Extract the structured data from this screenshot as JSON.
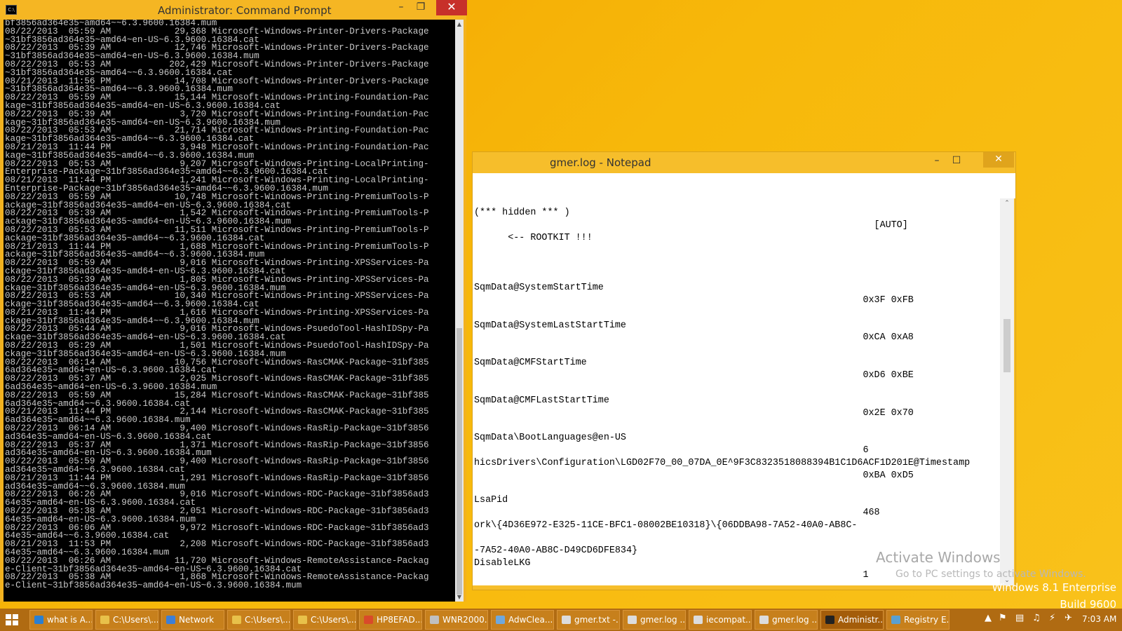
{
  "cmd": {
    "title": "Administrator: Command Prompt",
    "lines": [
      "bf3856ad364e35~amd64~~6.3.9600.16384.mum",
      "08/22/2013  05:59 AM            29,368 Microsoft-Windows-Printer-Drivers-Package",
      "~31bf3856ad364e35~amd64~en-US~6.3.9600.16384.cat",
      "08/22/2013  05:39 AM            12,746 Microsoft-Windows-Printer-Drivers-Package",
      "~31bf3856ad364e35~amd64~en-US~6.3.9600.16384.mum",
      "08/22/2013  05:53 AM           202,429 Microsoft-Windows-Printer-Drivers-Package",
      "~31bf3856ad364e35~amd64~~6.3.9600.16384.cat",
      "08/21/2013  11:56 PM            14,708 Microsoft-Windows-Printer-Drivers-Package",
      "~31bf3856ad364e35~amd64~~6.3.9600.16384.mum",
      "08/22/2013  05:59 AM            15,144 Microsoft-Windows-Printing-Foundation-Pac",
      "kage~31bf3856ad364e35~amd64~en-US~6.3.9600.16384.cat",
      "08/22/2013  05:39 AM             3,720 Microsoft-Windows-Printing-Foundation-Pac",
      "kage~31bf3856ad364e35~amd64~en-US~6.3.9600.16384.mum",
      "08/22/2013  05:53 AM            21,714 Microsoft-Windows-Printing-Foundation-Pac",
      "kage~31bf3856ad364e35~amd64~~6.3.9600.16384.cat",
      "08/21/2013  11:44 PM             3,948 Microsoft-Windows-Printing-Foundation-Pac",
      "kage~31bf3856ad364e35~amd64~~6.3.9600.16384.mum",
      "08/22/2013  05:53 AM             9,207 Microsoft-Windows-Printing-LocalPrinting-",
      "Enterprise-Package~31bf3856ad364e35~amd64~~6.3.9600.16384.cat",
      "08/21/2013  11:44 PM             1,241 Microsoft-Windows-Printing-LocalPrinting-",
      "Enterprise-Package~31bf3856ad364e35~amd64~~6.3.9600.16384.mum",
      "08/22/2013  05:59 AM            10,748 Microsoft-Windows-Printing-PremiumTools-P",
      "ackage~31bf3856ad364e35~amd64~en-US~6.3.9600.16384.cat",
      "08/22/2013  05:39 AM             1,542 Microsoft-Windows-Printing-PremiumTools-P",
      "ackage~31bf3856ad364e35~amd64~en-US~6.3.9600.16384.mum",
      "08/22/2013  05:53 AM            11,511 Microsoft-Windows-Printing-PremiumTools-P",
      "ackage~31bf3856ad364e35~amd64~~6.3.9600.16384.cat",
      "08/21/2013  11:44 PM             1,688 Microsoft-Windows-Printing-PremiumTools-P",
      "ackage~31bf3856ad364e35~amd64~~6.3.9600.16384.mum",
      "08/22/2013  05:59 AM             9,016 Microsoft-Windows-Printing-XPSServices-Pa",
      "ckage~31bf3856ad364e35~amd64~en-US~6.3.9600.16384.cat",
      "08/22/2013  05:39 AM             1,805 Microsoft-Windows-Printing-XPSServices-Pa",
      "ckage~31bf3856ad364e35~amd64~en-US~6.3.9600.16384.mum",
      "08/22/2013  05:53 AM            10,340 Microsoft-Windows-Printing-XPSServices-Pa",
      "ckage~31bf3856ad364e35~amd64~~6.3.9600.16384.cat",
      "08/21/2013  11:44 PM             1,616 Microsoft-Windows-Printing-XPSServices-Pa",
      "ckage~31bf3856ad364e35~amd64~~6.3.9600.16384.mum",
      "08/22/2013  05:44 AM             9,016 Microsoft-Windows-PsuedoTool-HashIDSpy-Pa",
      "ckage~31bf3856ad364e35~amd64~en-US~6.3.9600.16384.cat",
      "08/22/2013  05:29 AM             1,501 Microsoft-Windows-PsuedoTool-HashIDSpy-Pa",
      "ckage~31bf3856ad364e35~amd64~en-US~6.3.9600.16384.mum",
      "08/22/2013  06:14 AM            10,756 Microsoft-Windows-RasCMAK-Package~31bf385",
      "6ad364e35~amd64~en-US~6.3.9600.16384.cat",
      "08/22/2013  05:37 AM             2,025 Microsoft-Windows-RasCMAK-Package~31bf385",
      "6ad364e35~amd64~en-US~6.3.9600.16384.mum",
      "08/22/2013  05:59 AM            15,284 Microsoft-Windows-RasCMAK-Package~31bf385",
      "6ad364e35~amd64~~6.3.9600.16384.cat",
      "08/21/2013  11:44 PM             2,144 Microsoft-Windows-RasCMAK-Package~31bf385",
      "6ad364e35~amd64~~6.3.9600.16384.mum",
      "08/22/2013  06:14 AM             9,400 Microsoft-Windows-RasRip-Package~31bf3856",
      "ad364e35~amd64~en-US~6.3.9600.16384.cat",
      "08/22/2013  05:37 AM             1,371 Microsoft-Windows-RasRip-Package~31bf3856",
      "ad364e35~amd64~en-US~6.3.9600.16384.mum",
      "08/22/2013  05:59 AM             9,400 Microsoft-Windows-RasRip-Package~31bf3856",
      "ad364e35~amd64~~6.3.9600.16384.cat",
      "08/21/2013  11:44 PM             1,291 Microsoft-Windows-RasRip-Package~31bf3856",
      "ad364e35~amd64~~6.3.9600.16384.mum",
      "08/22/2013  06:26 AM             9,016 Microsoft-Windows-RDC-Package~31bf3856ad3",
      "64e35~amd64~en-US~6.3.9600.16384.cat",
      "08/22/2013  05:38 AM             2,051 Microsoft-Windows-RDC-Package~31bf3856ad3",
      "64e35~amd64~en-US~6.3.9600.16384.mum",
      "08/22/2013  06:06 AM             9,972 Microsoft-Windows-RDC-Package~31bf3856ad3",
      "64e35~amd64~~6.3.9600.16384.cat",
      "08/21/2013  11:53 PM             2,208 Microsoft-Windows-RDC-Package~31bf3856ad3",
      "64e35~amd64~~6.3.9600.16384.mum",
      "08/22/2013  06:26 AM            11,720 Microsoft-Windows-RemoteAssistance-Packag",
      "e-Client~31bf3856ad364e35~amd64~en-US~6.3.9600.16384.cat",
      "08/22/2013  05:38 AM             1,868 Microsoft-Windows-RemoteAssistance-Packag",
      "e-Client~31bf3856ad364e35~amd64~en-US~6.3.9600.16384.mum"
    ]
  },
  "notepad": {
    "title": "gmer.log - Notepad",
    "text": "(*** hidden *** )\n                                                                       [AUTO]\n      <-- ROOTKIT !!!\n\n\n\nSqmData@SystemStartTime\n                                                                     0x3F 0xFB\n\nSqmData@SystemLastStartTime\n                                                                     0xCA 0xA8\n\nSqmData@CMFStartTime\n                                                                     0xD6 0xBE\n\nSqmData@CMFLastStartTime\n                                                                     0x2E 0x70\n\nSqmData\\BootLanguages@en-US\n                                                                     6\nhicsDrivers\\Configuration\\LGD02F70_00_07DA_0E^9F3C8323518088394B1C1D6ACF1D201E@Timestamp\n                                                                     0xBA 0xD5\n\nLsaPid\n                                                                     468\nork\\{4D36E972-E325-11CE-BFC1-08002BE10318}\\{06DDBA98-7A52-40A0-AB8C-\n\n-7A52-40A0-AB8C-D49CD6DFE834}\nDisableLKG\n                                                                     1"
  },
  "watermark": {
    "line1": "Activate Windows",
    "line2": "Go to PC settings to activate Windows.",
    "edition": "Windows 8.1 Enterprise",
    "build": "Build 9600"
  },
  "taskbar": {
    "items": [
      {
        "label": "what is A...",
        "color": "#2a7fd1"
      },
      {
        "label": "C:\\Users\\...",
        "color": "#e8c14a"
      },
      {
        "label": "Network",
        "color": "#3d7fd6"
      },
      {
        "label": "C:\\Users\\...",
        "color": "#e8c14a"
      },
      {
        "label": "C:\\Users\\...",
        "color": "#e8c14a"
      },
      {
        "label": "HP8EFAD...",
        "color": "#d94a2a"
      },
      {
        "label": "WNR2000...",
        "color": "#c0c0c0"
      },
      {
        "label": "AdwClea...",
        "color": "#6fa8dc"
      },
      {
        "label": "gmer.txt -...",
        "color": "#dcdcdc"
      },
      {
        "label": "gmer.log ...",
        "color": "#dcdcdc"
      },
      {
        "label": "iecompat...",
        "color": "#dcdcdc"
      },
      {
        "label": "gmer.log ...",
        "color": "#dcdcdc"
      },
      {
        "label": "Administr...",
        "color": "#222222"
      },
      {
        "label": "Registry E...",
        "color": "#5aa0d0"
      }
    ],
    "time": "7:03 AM"
  }
}
